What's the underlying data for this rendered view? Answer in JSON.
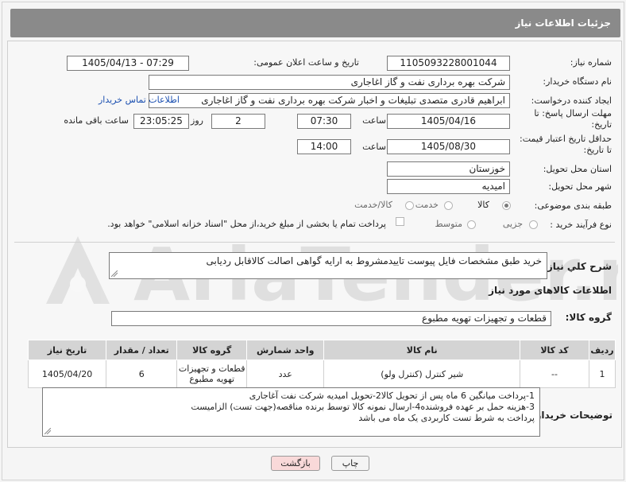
{
  "header": {
    "title": "جزئیات اطلاعات نیاز"
  },
  "need_number": {
    "label": "شماره نیاز:",
    "value": "1105093228001044"
  },
  "announce_datetime": {
    "label": "تاریخ و ساعت اعلان عمومی:",
    "value": "1405/04/13 - 07:29"
  },
  "buyer_org": {
    "label": "نام دستگاه خریدار:",
    "value": "شرکت بهره برداری نفت و گاز اغاجاری"
  },
  "requester": {
    "label": "ایجاد کننده درخواست:",
    "value": "ابراهیم قادری متصدی تبلیغات و اخبار شرکت بهره برداری نفت و گاز اغاجاری",
    "contact_link": "اطلاعات تماس خریدار"
  },
  "reply_deadline": {
    "label_line1": "مهلت ارسال پاسخ: تا",
    "label_line2": "تاریخ:",
    "date": "1405/04/16",
    "time_label": "ساعت",
    "time": "07:30",
    "days": "2",
    "days_label": "روز و",
    "remaining_time": "23:05:25",
    "remaining_label": "ساعت باقی مانده"
  },
  "price_validity": {
    "label_line1": "حداقل تاریخ اعتبار قیمت:",
    "label_line2": "تا تاریخ:",
    "date": "1405/08/30",
    "time_label": "ساعت",
    "time": "14:00"
  },
  "delivery_province": {
    "label": "استان محل تحویل:",
    "value": "خوزستان"
  },
  "delivery_city": {
    "label": "شهر محل تحویل:",
    "value": "امیدیه"
  },
  "category": {
    "label": "طبقه بندی موضوعی:",
    "options": [
      "کالا",
      "خدمت",
      "کالا/خدمت"
    ],
    "selected": "کالا"
  },
  "purchase_process": {
    "label": "نوع فرآیند خرید :",
    "options": [
      "جزیی",
      "متوسط"
    ],
    "payment_note": "پرداخت تمام یا بخشی از مبلغ خرید،از محل \"اسناد خزانه اسلامی\" خواهد بود."
  },
  "general_description": {
    "label": "شرح کلي نياز:",
    "value": "خرید طبق مشخصات فایل پیوست تاییدمشروط به ارایه گواهی اصالت کالاقابل ردیابی"
  },
  "goods_info": {
    "title": "اطلاعات کالاهای مورد نیاز"
  },
  "goods_group": {
    "label": "گروه کالا:",
    "value": "قطعات و تجهیزات تهویه مطبوع"
  },
  "table": {
    "headers": [
      "ردیف",
      "کد کالا",
      "نام کالا",
      "واحد شمارش",
      "گروه کالا",
      "تعداد / مقدار",
      "تاریخ نیاز"
    ],
    "rows": [
      {
        "row": "1",
        "code": "--",
        "name": "شیر کنترل (کنترل ولو)",
        "unit": "عدد",
        "group_line1": "قطعات و تجهیزات",
        "group_line2": "تهویه مطبوع",
        "qty": "6",
        "date": "1405/04/20"
      }
    ]
  },
  "buyer_notes": {
    "label": "توضیحات خریدار:",
    "line1": "1-پرداخت میانگین 6 ماه پس از تحویل کالا2-تحویل امیدیه شرکت نفت آغاجاری",
    "line2": "3-هزینه حمل بر عهده فروشنده4-ارسال نمونه کالا توسط برنده مناقصه(جهت تست) الزامیست",
    "line3": "پرداخت به شرط تست کاربردی یک ماه می باشد"
  },
  "buttons": {
    "print": "چاپ",
    "back": "بازگشت"
  },
  "watermark": {
    "text": "AriaTender.net"
  },
  "colors": {
    "header_bg": "#8a8a8a",
    "link": "#1a4fb0",
    "back_button_bg": "#f9d9d9",
    "table_header_bg": "#d4d4d4"
  }
}
